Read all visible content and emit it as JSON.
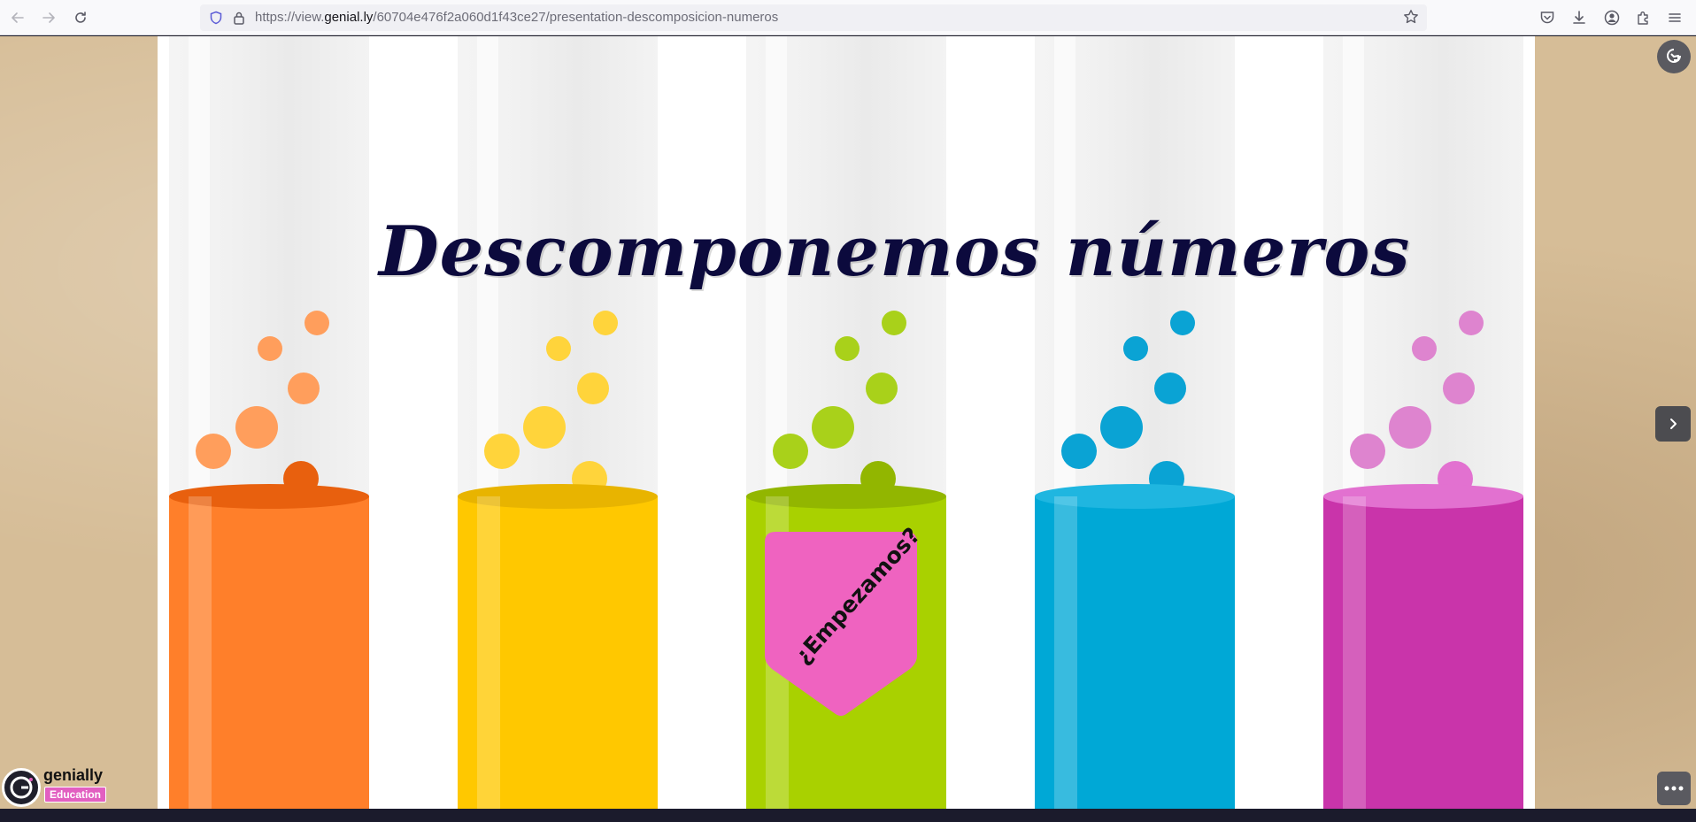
{
  "browser": {
    "url_prefix": "https://view.",
    "url_host": "genial.ly",
    "url_path": "/60704e476f2a060d1f43ce27/presentation-descomposicion-numeros"
  },
  "slide": {
    "title": "Descomponemos números",
    "start_label": "¿Empezamos?",
    "tubes": [
      {
        "name": "orange",
        "liquid_color": "#ff7f2a",
        "top_color": "#e8600e",
        "bubble_color": "#ff9e5c"
      },
      {
        "name": "yellow",
        "liquid_color": "#ffc800",
        "top_color": "#e8b400",
        "bubble_color": "#ffd43b"
      },
      {
        "name": "green",
        "liquid_color": "#a9d100",
        "top_color": "#92b600",
        "bubble_color": "#a9d11a"
      },
      {
        "name": "blue",
        "liquid_color": "#00a8d6",
        "top_color": "#1fb6e0",
        "bubble_color": "#0aa3d4"
      },
      {
        "name": "pink",
        "liquid_color": "#c934aa",
        "top_color": "#e271d0",
        "bubble_color": "#de84cf"
      }
    ],
    "tag_color": "#ef63c0"
  },
  "genially": {
    "brand": "genially",
    "edition": "Education"
  },
  "icons": {
    "back": "arrow-left-icon",
    "forward": "arrow-right-icon",
    "reload": "reload-icon",
    "shield": "shield-icon",
    "lock": "lock-icon",
    "star": "star-icon",
    "pocket": "pocket-icon",
    "download": "download-icon",
    "account": "account-icon",
    "extensions": "puzzle-icon",
    "menu": "hamburger-menu-icon",
    "fullscreen": "fullscreen-icon",
    "next": "chevron-right-icon",
    "more": "more-dots-icon"
  }
}
